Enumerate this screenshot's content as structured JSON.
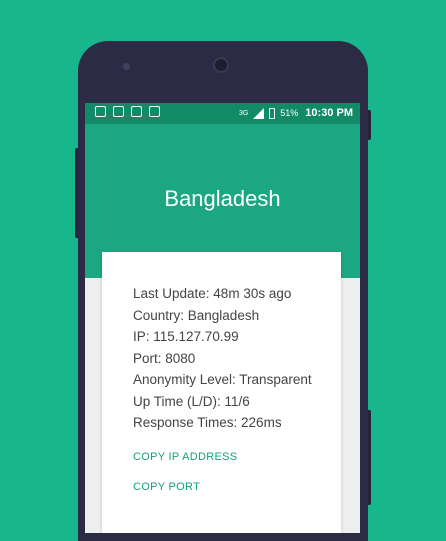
{
  "status_bar": {
    "network_type": "3G",
    "battery": "51%",
    "time": "10:30 PM"
  },
  "toolbar": {
    "title": "Bangladesh"
  },
  "proxy": {
    "last_update": "Last Update: 48m 30s ago",
    "country": "Country: Bangladesh",
    "ip": "IP: 115.127.70.99",
    "port": "Port: 8080",
    "anonymity": "Anonymity Level: Transparent",
    "uptime": "Up Time (L/D): 11/6",
    "response": "Response Times: 226ms"
  },
  "actions": {
    "copy_ip": "COPY IP ADDRESS",
    "copy_port": "COPY PORT"
  },
  "colors": {
    "background": "#17b68c",
    "toolbar": "#1aa782",
    "status_bar": "#138a66",
    "accent": "#15a07d"
  }
}
